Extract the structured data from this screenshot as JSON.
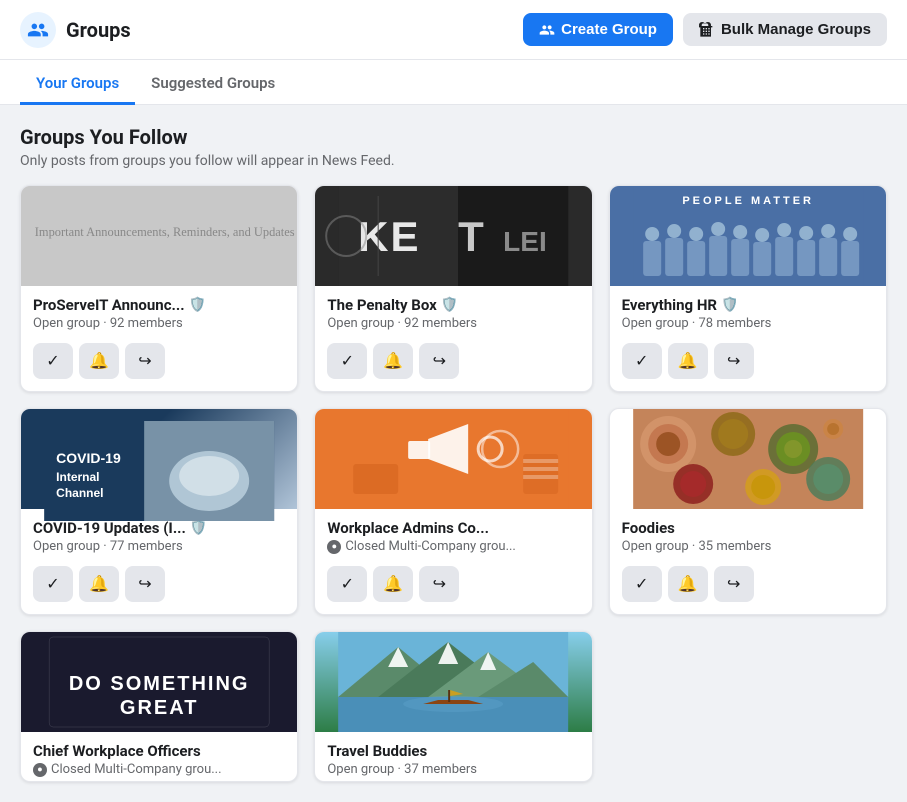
{
  "header": {
    "title": "Groups",
    "icon": "👥",
    "create_button": "Create Group",
    "bulk_button": "Bulk Manage Groups"
  },
  "tabs": [
    {
      "id": "your-groups",
      "label": "Your Groups",
      "active": true
    },
    {
      "id": "suggested-groups",
      "label": "Suggested Groups",
      "active": false
    }
  ],
  "section": {
    "title": "Groups You Follow",
    "subtitle": "Only posts from groups you follow will appear in News Feed."
  },
  "groups": [
    {
      "id": "proserve",
      "name": "ProServeIT Announc...",
      "meta": "Open group · 92 members",
      "cover_type": "announce",
      "verified": true,
      "closed": false
    },
    {
      "id": "penalty-box",
      "name": "The Penalty Box",
      "meta": "Open group · 92 members",
      "cover_type": "hockey",
      "verified": true,
      "closed": false
    },
    {
      "id": "everything-hr",
      "name": "Everything HR",
      "meta": "Open group · 78 members",
      "cover_type": "hr",
      "verified": true,
      "closed": false
    },
    {
      "id": "covid-updates",
      "name": "COVID-19 Updates (I...",
      "meta": "Open group · 77 members",
      "cover_type": "covid",
      "cover_line1": "COVID-19",
      "cover_line2": "Internal Channel",
      "verified": true,
      "closed": false
    },
    {
      "id": "workplace-admins",
      "name": "Workplace Admins Co...",
      "meta": "Closed Multi-Company grou...",
      "cover_type": "workplace",
      "verified": false,
      "closed": true
    },
    {
      "id": "foodies",
      "name": "Foodies",
      "meta": "Open group · 35 members",
      "cover_type": "foodies",
      "verified": false,
      "closed": false
    },
    {
      "id": "chief-workplace",
      "name": "Chief Workplace Officers",
      "meta": "Closed Multi-Company grou...",
      "cover_type": "chief",
      "cover_text": "DO SOMETHING GREAT",
      "verified": false,
      "closed": true
    },
    {
      "id": "travel-buddies",
      "name": "Travel Buddies",
      "meta": "Open group · 37 members",
      "cover_type": "travel",
      "verified": false,
      "closed": false
    }
  ],
  "action_icons": {
    "check": "✓",
    "bell": "🔔",
    "share": "↪"
  }
}
